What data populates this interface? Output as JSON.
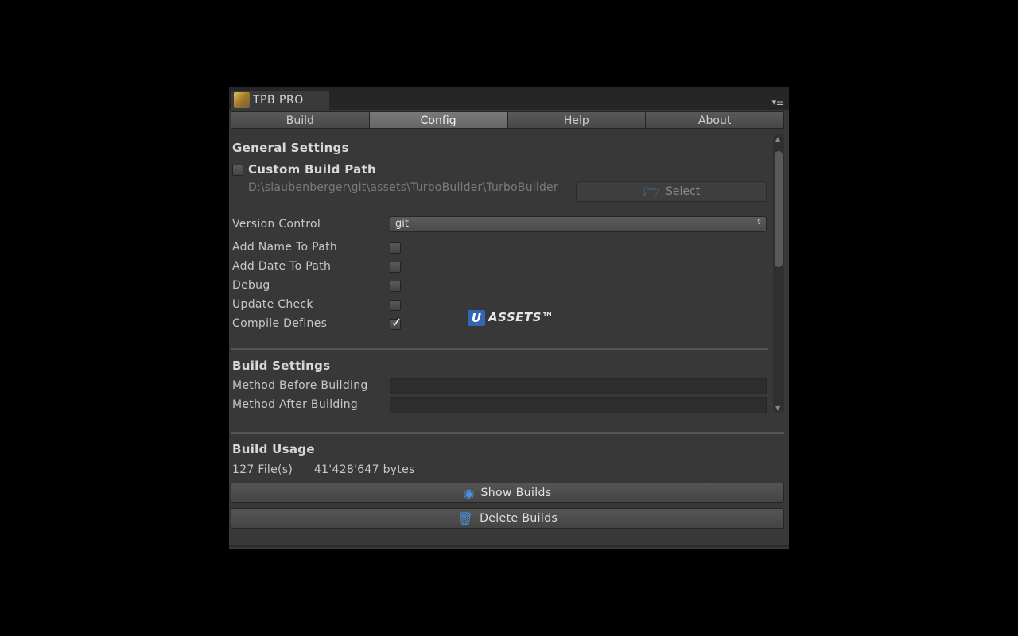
{
  "window": {
    "title": "TPB PRO",
    "menu_icon": "▾☰"
  },
  "tabs": [
    {
      "label": "Build",
      "active": false
    },
    {
      "label": "Config",
      "active": true
    },
    {
      "label": "Help",
      "active": false
    },
    {
      "label": "About",
      "active": false
    }
  ],
  "general": {
    "title": "General Settings",
    "custom_build_path": {
      "label": "Custom Build Path",
      "checked": false
    },
    "path": "D:\\slaubenberger\\git\\assets\\TurboBuilder\\TurboBuilder",
    "select_button": {
      "label": "Select",
      "icon": "folder-icon"
    },
    "version_control": {
      "label": "Version Control",
      "value": "git"
    },
    "options": [
      {
        "label": "Add Name To Path",
        "checked": false
      },
      {
        "label": "Add Date To Path",
        "checked": false
      },
      {
        "label": "Debug",
        "checked": false
      },
      {
        "label": "Update Check",
        "checked": false
      },
      {
        "label": "Compile Defines",
        "checked": true
      }
    ]
  },
  "logo": {
    "letter": "U",
    "text": "ASSETS™"
  },
  "build_settings": {
    "title": "Build Settings",
    "method_before": {
      "label": "Method Before Building",
      "value": ""
    },
    "method_after": {
      "label": "Method After Building",
      "value": ""
    }
  },
  "build_usage": {
    "title": "Build Usage",
    "files": "127 File(s)",
    "bytes": "41'428'647 bytes",
    "show_button": {
      "label": "Show Builds",
      "icon": "eye-icon"
    },
    "delete_button": {
      "label": "Delete Builds",
      "icon": "trash-icon"
    }
  },
  "colors": {
    "accent": "#4a8fd8",
    "panel": "#383838",
    "logo_blue": "#3464b4"
  }
}
